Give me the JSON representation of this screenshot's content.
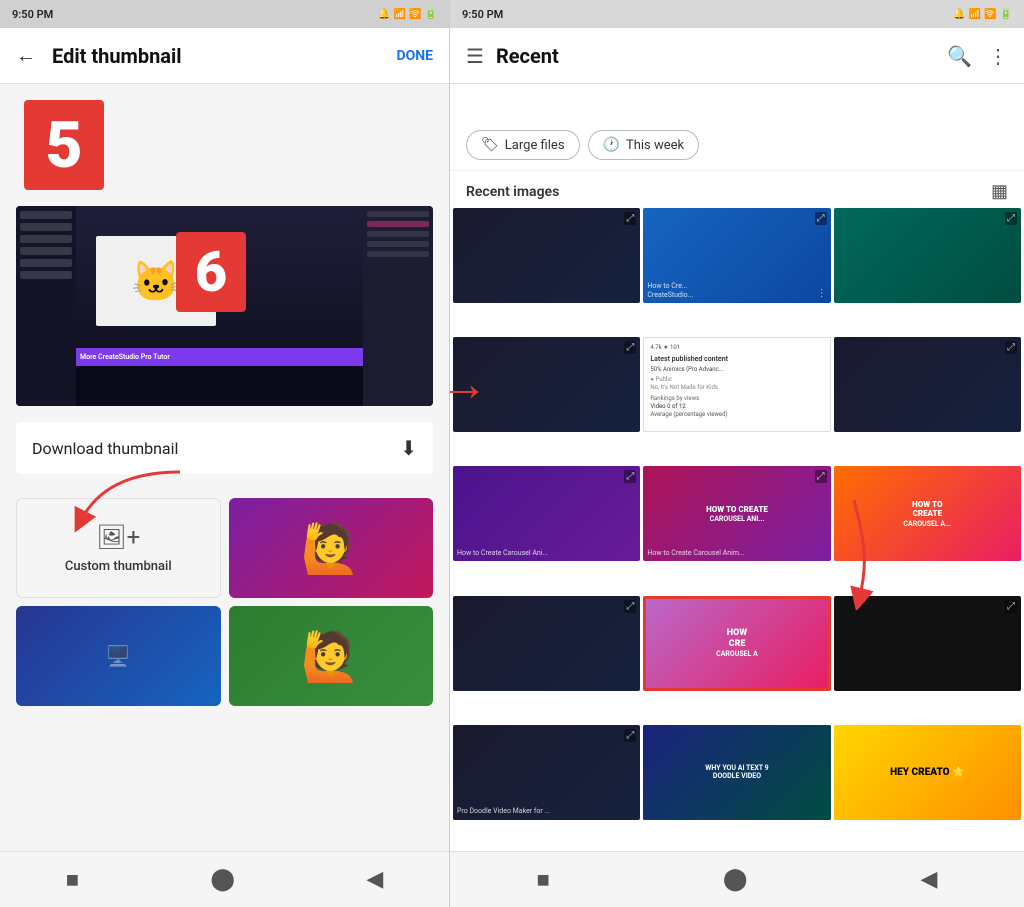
{
  "left_phone": {
    "status_bar": {
      "time": "9:50 PM",
      "icons": "🔔 📶 🔋"
    },
    "app_bar": {
      "back": "←",
      "title": "Edit thumbnail",
      "action": "DONE"
    },
    "step_number": "5",
    "purple_bar_text": "More CreateStudio Pro Tutor",
    "download_row": {
      "label": "Download thumbnail",
      "icon": "⬇"
    },
    "thumbnails": [
      {
        "type": "custom",
        "label": "Custom thumbnail"
      },
      {
        "type": "person1"
      },
      {
        "type": "screen"
      },
      {
        "type": "person2"
      }
    ],
    "bottom_nav": [
      "■",
      "⬤",
      "◀"
    ]
  },
  "right_phone": {
    "status_bar": {
      "time": "9:50 PM",
      "icons": "🔔 📶 🔋"
    },
    "app_bar": {
      "menu": "☰",
      "title": "Recent",
      "search": "🔍",
      "more": "⋮"
    },
    "step_number": "6",
    "filters": [
      {
        "icon": "🏷",
        "label": "Large files"
      },
      {
        "icon": "🕐",
        "label": "This week"
      }
    ],
    "section_title": "Recent images",
    "grid_toggle": "▦",
    "bottom_nav": [
      "■",
      "⬤",
      "◀"
    ],
    "images": [
      {
        "type": "dark",
        "text": ""
      },
      {
        "type": "blue",
        "text": "How to Cre... CreateStudio..."
      },
      {
        "type": "teal",
        "text": ""
      },
      {
        "type": "dark",
        "text": ""
      },
      {
        "type": "card",
        "text": "4.7k ⭐ 101"
      },
      {
        "type": "dark",
        "text": ""
      },
      {
        "type": "dark",
        "text": ""
      },
      {
        "type": "purple-anim",
        "text": "How to Create Carousel Ani..."
      },
      {
        "type": "person-pink",
        "text": "HOW TO CRE... CAROUSEL A"
      },
      {
        "type": "dark2",
        "text": ""
      },
      {
        "type": "selected-purple",
        "text": "HOW CRE CAROUSEL A",
        "selected": true
      },
      {
        "type": "black-dark",
        "text": ""
      },
      {
        "type": "dark3",
        "text": ""
      },
      {
        "type": "dark4",
        "text": ""
      },
      {
        "type": "green-chalk",
        "text": "WHY YOU AI TEXT 9 DOODLE VIDEO..."
      },
      {
        "type": "dark5",
        "text": ""
      },
      {
        "type": "dark6",
        "text": ""
      },
      {
        "type": "yellow-creator",
        "text": "HEY CREATO 🌟"
      }
    ]
  },
  "arrow": "→"
}
